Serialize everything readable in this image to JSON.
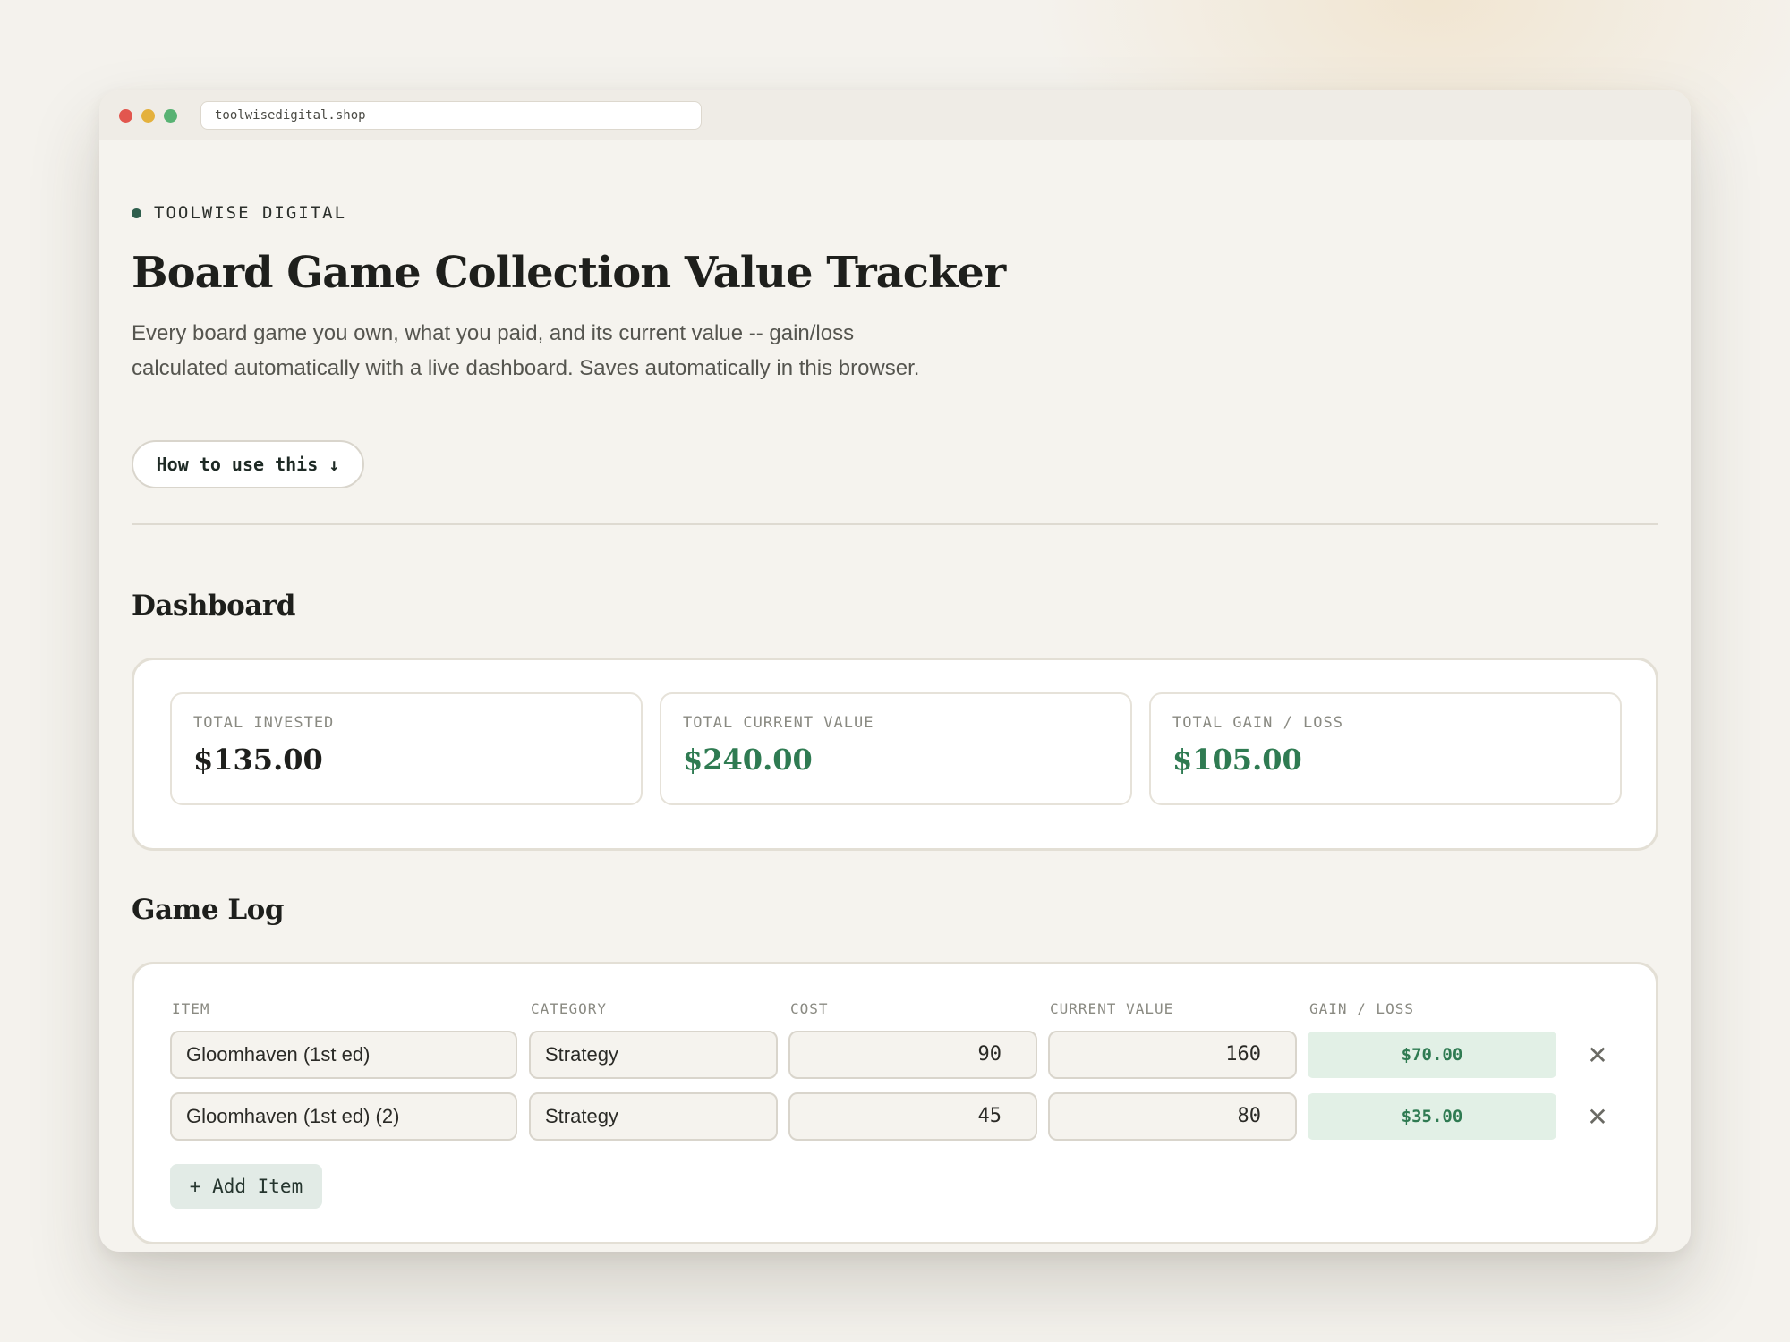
{
  "browser": {
    "url": "toolwisedigital.shop"
  },
  "header": {
    "brand": "TOOLWISE DIGITAL",
    "title": "Board Game Collection Value Tracker",
    "description": "Every board game you own, what you paid, and its current value -- gain/loss calculated automatically with a live dashboard. Saves automatically in this browser.",
    "how_to_label": "How to use this ↓"
  },
  "dashboard": {
    "heading": "Dashboard",
    "cards": [
      {
        "label": "TOTAL INVESTED",
        "value": "$135.00"
      },
      {
        "label": "TOTAL CURRENT VALUE",
        "value": "$240.00"
      },
      {
        "label": "TOTAL GAIN / LOSS",
        "value": "$105.00"
      }
    ]
  },
  "game_log": {
    "heading": "Game Log",
    "columns": {
      "item": "ITEM",
      "category": "CATEGORY",
      "cost": "COST",
      "current_value": "CURRENT VALUE",
      "gain_loss": "GAIN / LOSS"
    },
    "rows": [
      {
        "item": "Gloomhaven (1st ed)",
        "category": "Strategy",
        "cost": "90",
        "current_value": "160",
        "gain_loss": "$70.00"
      },
      {
        "item": "Gloomhaven (1st ed) (2)",
        "category": "Strategy",
        "cost": "45",
        "current_value": "80",
        "gain_loss": "$35.00"
      }
    ],
    "delete_glyph": "✕",
    "add_label": "+ Add Item"
  },
  "colors": {
    "positive": "#2f7b52",
    "brand_dot": "#2e5e4c",
    "gain_bg": "#e2f0e6"
  },
  "icons": [
    "close-icon",
    "brand-dot-icon",
    "arrow-down-icon"
  ]
}
